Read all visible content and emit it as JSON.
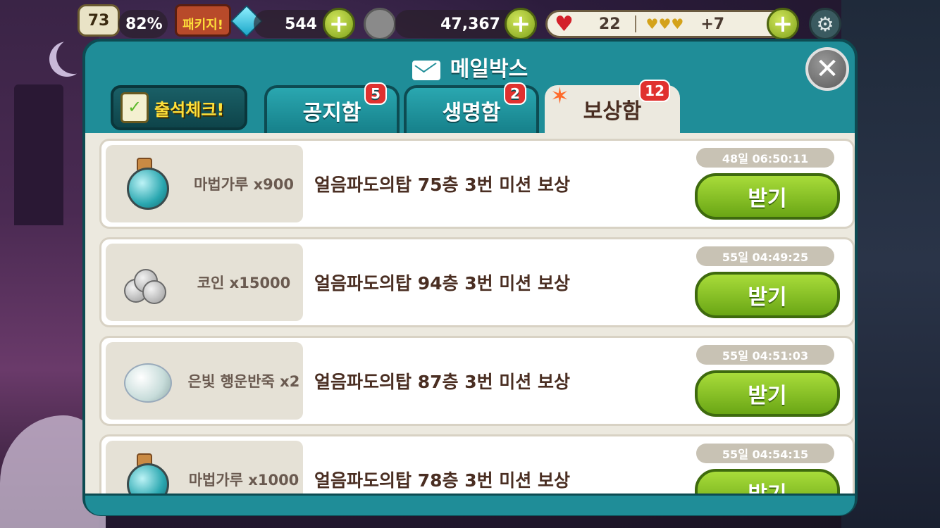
{
  "topbar": {
    "level": "73",
    "exp_percent": "82%",
    "package_label": "패키지!",
    "gems": "544",
    "coins": "47,367",
    "hearts": "22",
    "heart_bonus": "+7",
    "plus_label": "+",
    "settings_icon": "gear-icon"
  },
  "mailbox": {
    "title": "메일박스",
    "close_label": "✕",
    "attendance_label": "출석체크!",
    "tabs": [
      {
        "label": "공지함",
        "badge": "5",
        "active": false
      },
      {
        "label": "생명함",
        "badge": "2",
        "active": false
      },
      {
        "label": "보상함",
        "badge": "12",
        "active": true
      }
    ],
    "items": [
      {
        "icon": "magic-powder-potion-icon",
        "reward": "마법가루 x900",
        "desc": "얼음파도의탑 75층 3번 미션 보상",
        "time": "48일 06:50:11",
        "button": "받기"
      },
      {
        "icon": "silver-coins-icon",
        "reward": "코인 x15000",
        "desc": "얼음파도의탑 94층 3번 미션 보상",
        "time": "55일 04:49:25",
        "button": "받기"
      },
      {
        "icon": "silver-pearl-icon",
        "reward": "은빛 행운반죽 x2",
        "desc": "얼음파도의탑 87층 3번 미션 보상",
        "time": "55일 04:51:03",
        "button": "받기"
      },
      {
        "icon": "magic-powder-potion-icon",
        "reward": "마법가루 x1000",
        "desc": "얼음파도의탑 78층 3번 미션 보상",
        "time": "55일 04:54:15",
        "button": "받기"
      }
    ]
  },
  "colors": {
    "panel_teal": "#1f8d98",
    "panel_border": "#0d4b52",
    "receive_green": "#8cc22a",
    "badge_red": "#e0312f",
    "list_bg": "#ece9df"
  }
}
